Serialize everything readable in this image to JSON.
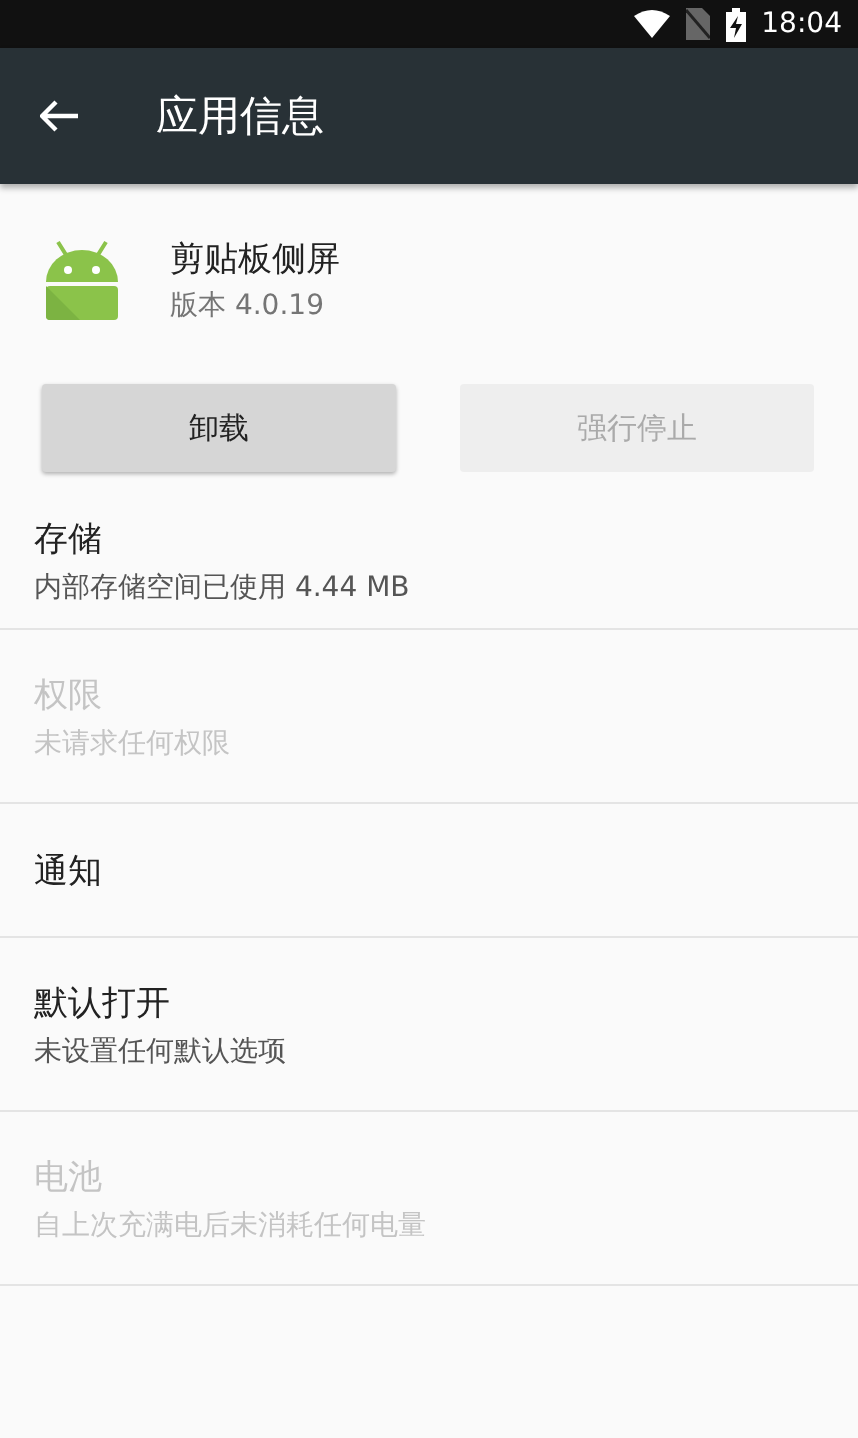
{
  "status_bar": {
    "time": "18:04"
  },
  "toolbar": {
    "title": "应用信息"
  },
  "app": {
    "name": "剪贴板侧屏",
    "version": "版本 4.0.19"
  },
  "buttons": [
    {
      "label": "卸载",
      "disabled": false
    },
    {
      "label": "强行停止",
      "disabled": true
    }
  ],
  "items": [
    {
      "title": "存储",
      "summary": "内部存储空间已使用 4.44 MB",
      "disabled": false
    },
    {
      "title": "权限",
      "summary": "未请求任何权限",
      "disabled": true
    },
    {
      "title": "通知",
      "disabled": false
    },
    {
      "title": "默认打开",
      "summary": "未设置任何默认选项",
      "disabled": false
    },
    {
      "title": "电池",
      "summary": "自上次充满电后未消耗任何电量",
      "disabled": true
    }
  ]
}
